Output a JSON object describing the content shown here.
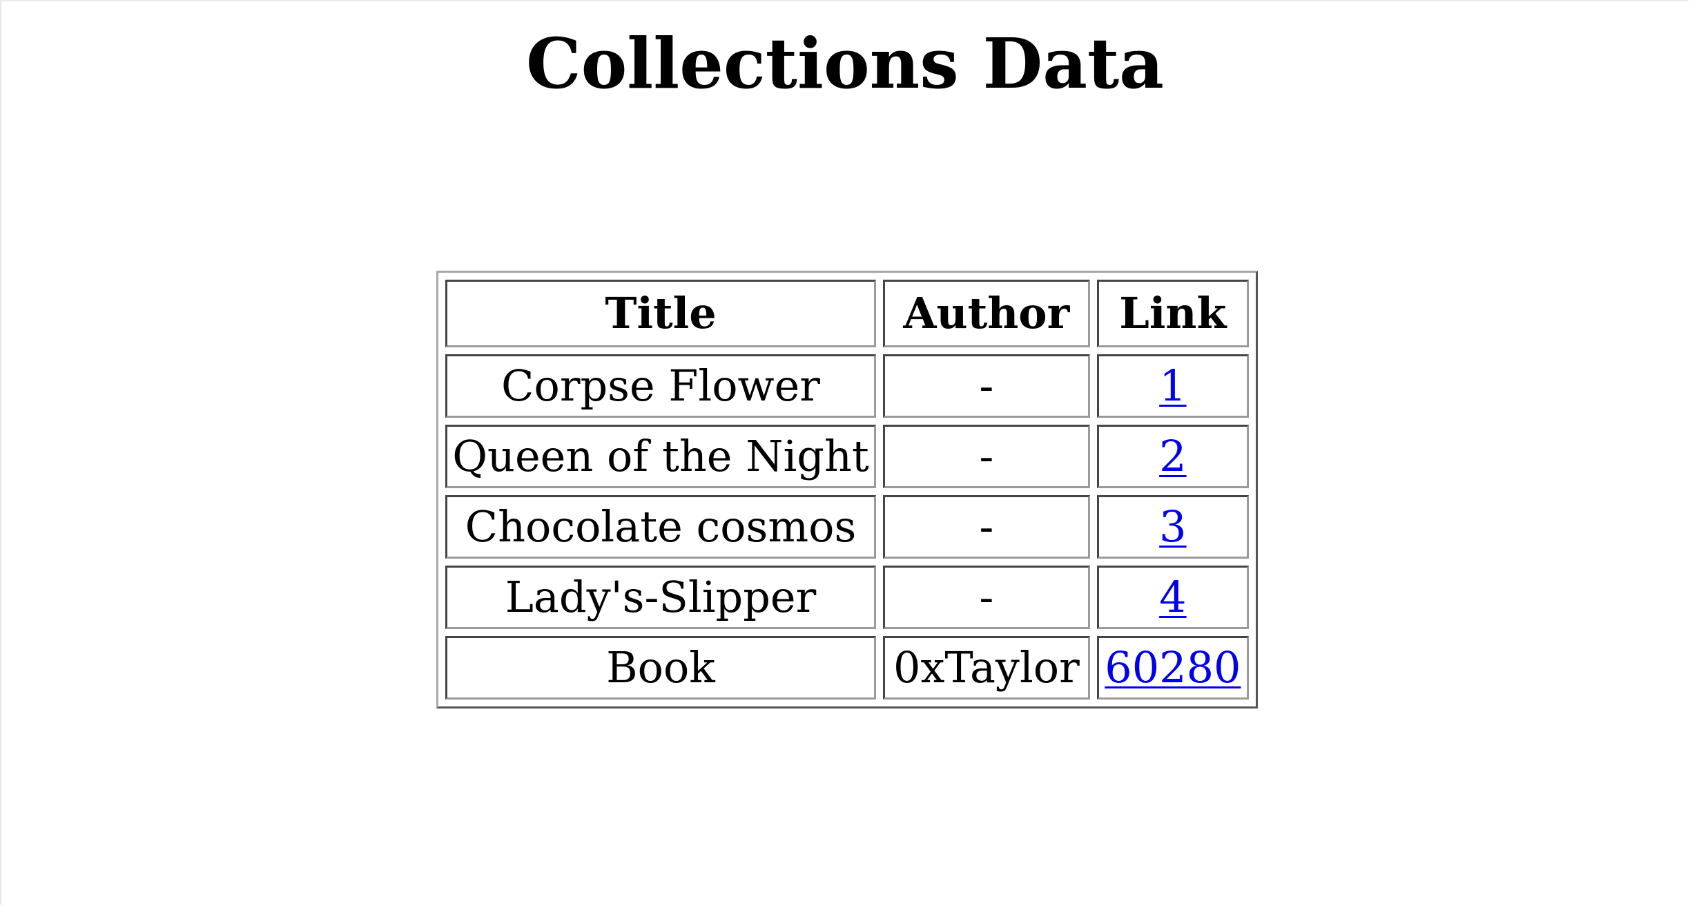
{
  "page": {
    "title": "Collections Data"
  },
  "table": {
    "headers": [
      "Title",
      "Author",
      "Link"
    ],
    "rows": [
      {
        "title": "Corpse Flower",
        "author": "-",
        "link": "1"
      },
      {
        "title": "Queen of the Night",
        "author": "-",
        "link": "2"
      },
      {
        "title": "Chocolate cosmos",
        "author": "-",
        "link": "3"
      },
      {
        "title": "Lady's-Slipper",
        "author": "-",
        "link": "4"
      },
      {
        "title": "Book",
        "author": "0xTaylor",
        "link": "60280"
      }
    ]
  },
  "colors": {
    "link": "#0000ee",
    "text": "#000000",
    "background": "#ffffff"
  }
}
